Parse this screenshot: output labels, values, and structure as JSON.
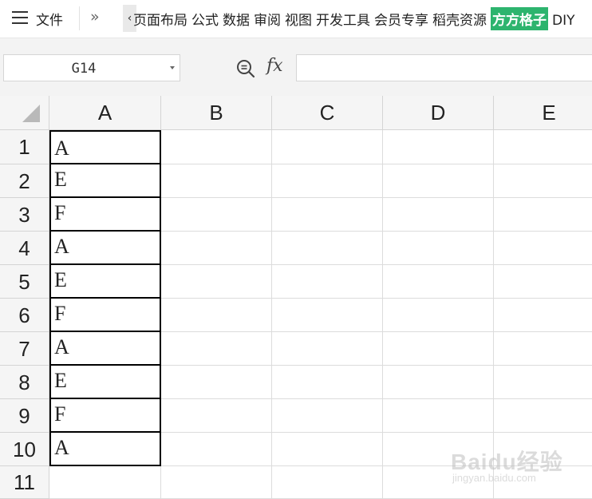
{
  "menubar": {
    "file_label": "文件",
    "more_glyph": "»",
    "scroll_left_glyph": "‹",
    "tabs": [
      "页面布局",
      "公式",
      "数据",
      "审阅",
      "视图",
      "开发工具",
      "会员专享",
      "稻壳资源"
    ],
    "highlight_tab": "方方格子",
    "last_tab": "DIY",
    "highlight_color": "#2db46e"
  },
  "formula_bar": {
    "name_box_value": "G14",
    "fx_label": "fx",
    "formula_value": ""
  },
  "grid": {
    "columns": [
      "A",
      "B",
      "C",
      "D",
      "E"
    ],
    "rows": [
      "1",
      "2",
      "3",
      "4",
      "5",
      "6",
      "7",
      "8",
      "9",
      "10",
      "11"
    ],
    "column_a_values": [
      "A",
      "E",
      "F",
      "A",
      "E",
      "F",
      "A",
      "E",
      "F",
      "A"
    ]
  },
  "watermark": {
    "brand": "Baidu经验",
    "url": "jingyan.baidu.com"
  }
}
